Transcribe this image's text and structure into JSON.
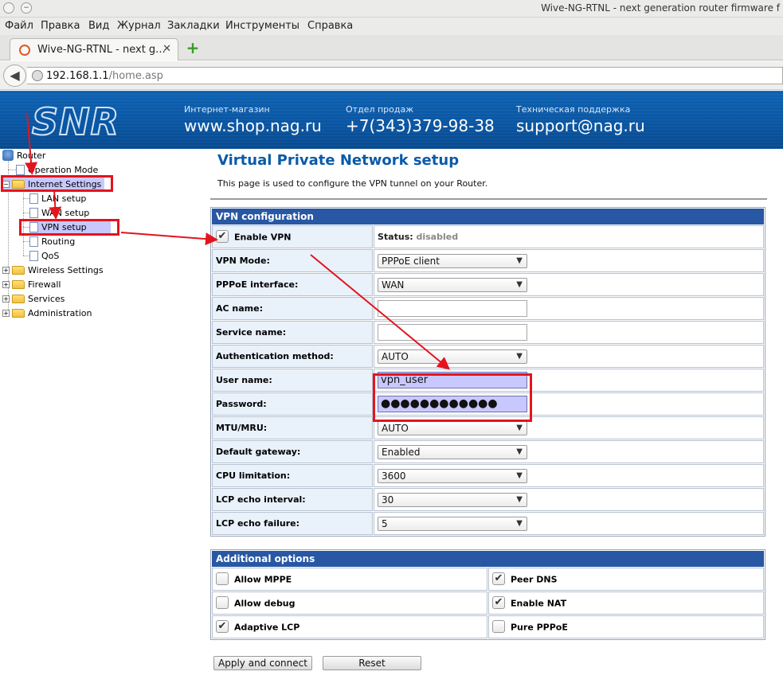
{
  "window": {
    "title": "Wive-NG-RTNL - next generation router firmware f"
  },
  "menu": [
    "Файл",
    "Правка",
    "Вид",
    "Журнал",
    "Закладки",
    "Инструменты",
    "Справка"
  ],
  "tab": {
    "label": "Wive-NG-RTNL - next g...",
    "close": "✕",
    "new_tab": "+"
  },
  "address": {
    "host": "192.168.1.1",
    "path": "/home.asp"
  },
  "banner": {
    "logo": "SNR",
    "shop_caption": "Интернет-магазин",
    "shop_value": "www.shop.nag.ru",
    "sales_caption": "Отдел продаж",
    "sales_value": "+7(343)379-98-38",
    "support_caption": "Техническая поддержка",
    "support_value": "support@nag.ru"
  },
  "tree": {
    "root": "Router",
    "operation_mode": "Operation Mode",
    "internet_settings": "Internet Settings",
    "lan_setup": "LAN setup",
    "wan_setup": "WAN setup",
    "vpn_setup": "VPN setup",
    "routing": "Routing",
    "qos": "QoS",
    "wireless_settings": "Wireless Settings",
    "firewall": "Firewall",
    "services": "Services",
    "administration": "Administration"
  },
  "page": {
    "title": "Virtual Private Network setup",
    "description": "This page is used to configure the VPN tunnel on your Router."
  },
  "vpn": {
    "header": "VPN configuration",
    "enable_label": "Enable VPN",
    "enable_checked": true,
    "status_label": "Status:",
    "status_value": "disabled",
    "mode_label": "VPN Mode:",
    "mode_value": "PPPoE client",
    "pppoe_if_label": "PPPoE interface:",
    "pppoe_if_value": "WAN",
    "ac_name_label": "AC name:",
    "ac_name_value": "",
    "service_name_label": "Service name:",
    "service_name_value": "",
    "auth_label": "Authentication method:",
    "auth_value": "AUTO",
    "user_label": "User name:",
    "user_value": "vpn_user",
    "password_label": "Password:",
    "password_value": "●●●●●●●●●●●●",
    "mtu_label": "MTU/MRU:",
    "mtu_value": "AUTO",
    "gateway_label": "Default gateway:",
    "gateway_value": "Enabled",
    "cpu_label": "CPU limitation:",
    "cpu_value": "3600",
    "lcp_interval_label": "LCP echo interval:",
    "lcp_interval_value": "30",
    "lcp_failure_label": "LCP echo failure:",
    "lcp_failure_value": "5"
  },
  "options": {
    "header": "Additional options",
    "allow_mppe": "Allow MPPE",
    "peer_dns": "Peer DNS",
    "allow_debug": "Allow debug",
    "enable_nat": "Enable NAT",
    "adaptive_lcp": "Adaptive LCP",
    "pure_pppoe": "Pure PPPoE",
    "check_mark": "✔"
  },
  "buttons": {
    "apply": "Apply and connect",
    "reset": "Reset"
  },
  "colors": {
    "accent": "#0a5aaa",
    "table_header": "#2857a4",
    "highlight": "#c8c8ff",
    "annotation": "#e3141e"
  }
}
